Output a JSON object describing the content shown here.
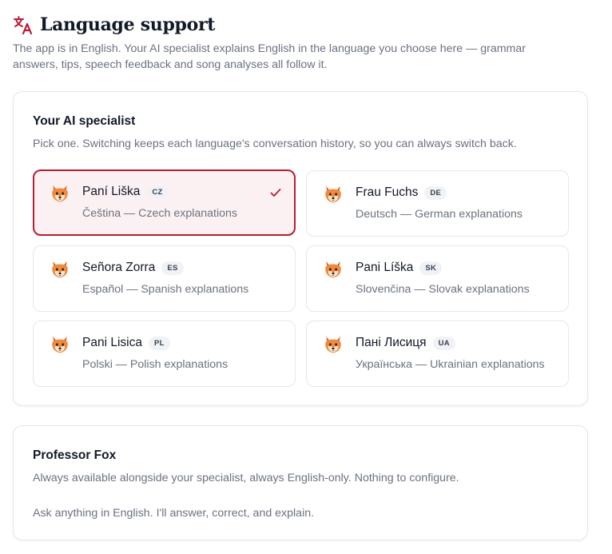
{
  "header": {
    "title": "Language support",
    "icon": "translate-icon",
    "accent_color": "#b91c35"
  },
  "intro": "The app is in English. Your AI specialist explains English in the language you choose here — grammar answers, tips, speech feedback and song analyses all follow it.",
  "specialist": {
    "title": "Your AI specialist",
    "description": "Pick one. Switching keeps each language's conversation history, so you can always switch back.",
    "selected": "cz",
    "options": [
      {
        "name": "Paní Liška",
        "code": "CZ",
        "desc": "Čeština — Czech explanations",
        "icon": "fox-icon"
      },
      {
        "name": "Frau Fuchs",
        "code": "DE",
        "desc": "Deutsch — German explanations",
        "icon": "fox-icon"
      },
      {
        "name": "Señora Zorra",
        "code": "ES",
        "desc": "Español — Spanish explanations",
        "icon": "fox-icon"
      },
      {
        "name": "Pani Líška",
        "code": "SK",
        "desc": "Slovenčina — Slovak explanations",
        "icon": "fox-icon"
      },
      {
        "name": "Pani Lisica",
        "code": "PL",
        "desc": "Polski — Polish explanations",
        "icon": "fox-icon"
      },
      {
        "name": "Пані Лисиця",
        "code": "UA",
        "desc": "Українська — Ukrainian explanations",
        "icon": "fox-icon"
      }
    ]
  },
  "professor": {
    "title": "Professor Fox",
    "description": "Always available alongside your specialist, always English-only. Nothing to configure.",
    "note": "Ask anything in English. I'll answer, correct, and explain."
  }
}
